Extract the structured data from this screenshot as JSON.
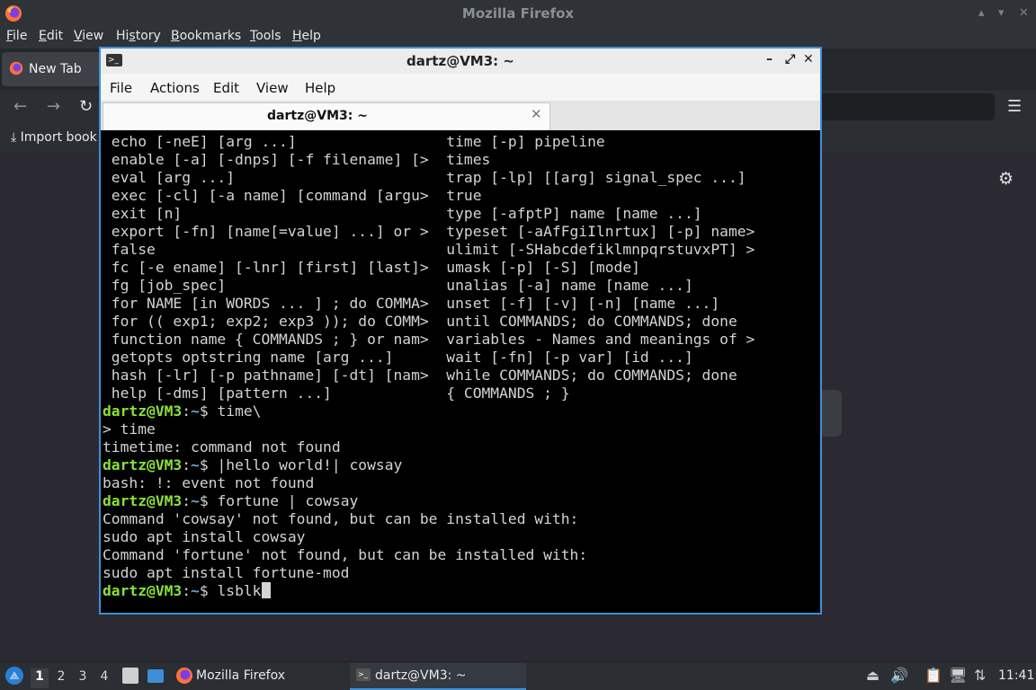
{
  "firefox": {
    "window_title": "Mozilla Firefox",
    "window_controls": [
      "▴",
      "▾",
      "✕"
    ],
    "menu": [
      {
        "pre": "",
        "ul": "F",
        "post": "ile"
      },
      {
        "pre": "",
        "ul": "E",
        "post": "dit"
      },
      {
        "pre": "",
        "ul": "V",
        "post": "iew"
      },
      {
        "pre": "Hi",
        "ul": "s",
        "post": "tory"
      },
      {
        "pre": "",
        "ul": "B",
        "post": "ookmarks"
      },
      {
        "pre": "",
        "ul": "T",
        "post": "ools"
      },
      {
        "pre": "",
        "ul": "H",
        "post": "elp"
      }
    ],
    "tab_label": "New Tab",
    "import_label": "Import book",
    "icons": {
      "back": "←",
      "forward": "→",
      "reload": "↻",
      "menu": "☰",
      "settings": "⚙"
    }
  },
  "terminal": {
    "window_title": "dartz@VM3: ~",
    "window_controls": [
      "–",
      "⤢",
      "✕"
    ],
    "menu": [
      "File",
      "Actions",
      "Edit",
      "View",
      "Help"
    ],
    "tab_label": "dartz@VM3: ~",
    "tab_close": "✕",
    "lines": [
      {
        "text": " echo [-neE] [arg ...]                 time [-p] pipeline"
      },
      {
        "text": " enable [-a] [-dnps] [-f filename] [>  times"
      },
      {
        "text": " eval [arg ...]                        trap [-lp] [[arg] signal_spec ...]"
      },
      {
        "text": " exec [-cl] [-a name] [command [argu>  true"
      },
      {
        "text": " exit [n]                              type [-afptP] name [name ...]"
      },
      {
        "text": " export [-fn] [name[=value] ...] or >  typeset [-aAfFgiIlnrtux] [-p] name>"
      },
      {
        "text": " false                                 ulimit [-SHabcdefiklmnpqrstuvxPT] >"
      },
      {
        "text": " fc [-e ename] [-lnr] [first] [last]>  umask [-p] [-S] [mode]"
      },
      {
        "text": " fg [job_spec]                         unalias [-a] name [name ...]"
      },
      {
        "text": " for NAME [in WORDS ... ] ; do COMMA>  unset [-f] [-v] [-n] [name ...]"
      },
      {
        "text": " for (( exp1; exp2; exp3 )); do COMM>  until COMMANDS; do COMMANDS; done"
      },
      {
        "text": " function name { COMMANDS ; } or nam>  variables - Names and meanings of >"
      },
      {
        "text": " getopts optstring name [arg ...]      wait [-fn] [-p var] [id ...]"
      },
      {
        "text": " hash [-lr] [-p pathname] [-dt] [nam>  while COMMANDS; do COMMANDS; done"
      },
      {
        "text": " help [-dms] [pattern ...]             { COMMANDS ; }"
      },
      {
        "prompt_user": "dartz@VM3",
        "prompt_path": "~",
        "cmd": " time\\"
      },
      {
        "text": "> time"
      },
      {
        "text": "timetime: command not found"
      },
      {
        "prompt_user": "dartz@VM3",
        "prompt_path": "~",
        "cmd": " |hello world!| cowsay"
      },
      {
        "text": "bash: !: event not found"
      },
      {
        "prompt_user": "dartz@VM3",
        "prompt_path": "~",
        "cmd": " fortune | cowsay"
      },
      {
        "text": "Command 'cowsay' not found, but can be installed with:"
      },
      {
        "text": "sudo apt install cowsay"
      },
      {
        "text": "Command 'fortune' not found, but can be installed with:"
      },
      {
        "text": "sudo apt install fortune-mod"
      },
      {
        "prompt_user": "dartz@VM3",
        "prompt_path": "~",
        "cmd": " lsblk",
        "cursor": true
      }
    ]
  },
  "taskbar": {
    "workspaces": [
      "1",
      "2",
      "3",
      "4"
    ],
    "firefox_label": "Mozilla Firefox",
    "terminal_label": "dartz@VM3: ~",
    "tray_icons": [
      "⏏",
      "🔊",
      "📋",
      "🖥",
      "⇅"
    ],
    "clock": "11:41"
  },
  "colors": {
    "prompt_user": "#8ae234",
    "prompt_path": "#729fcf",
    "terminal_border": "#3d8fd6"
  }
}
